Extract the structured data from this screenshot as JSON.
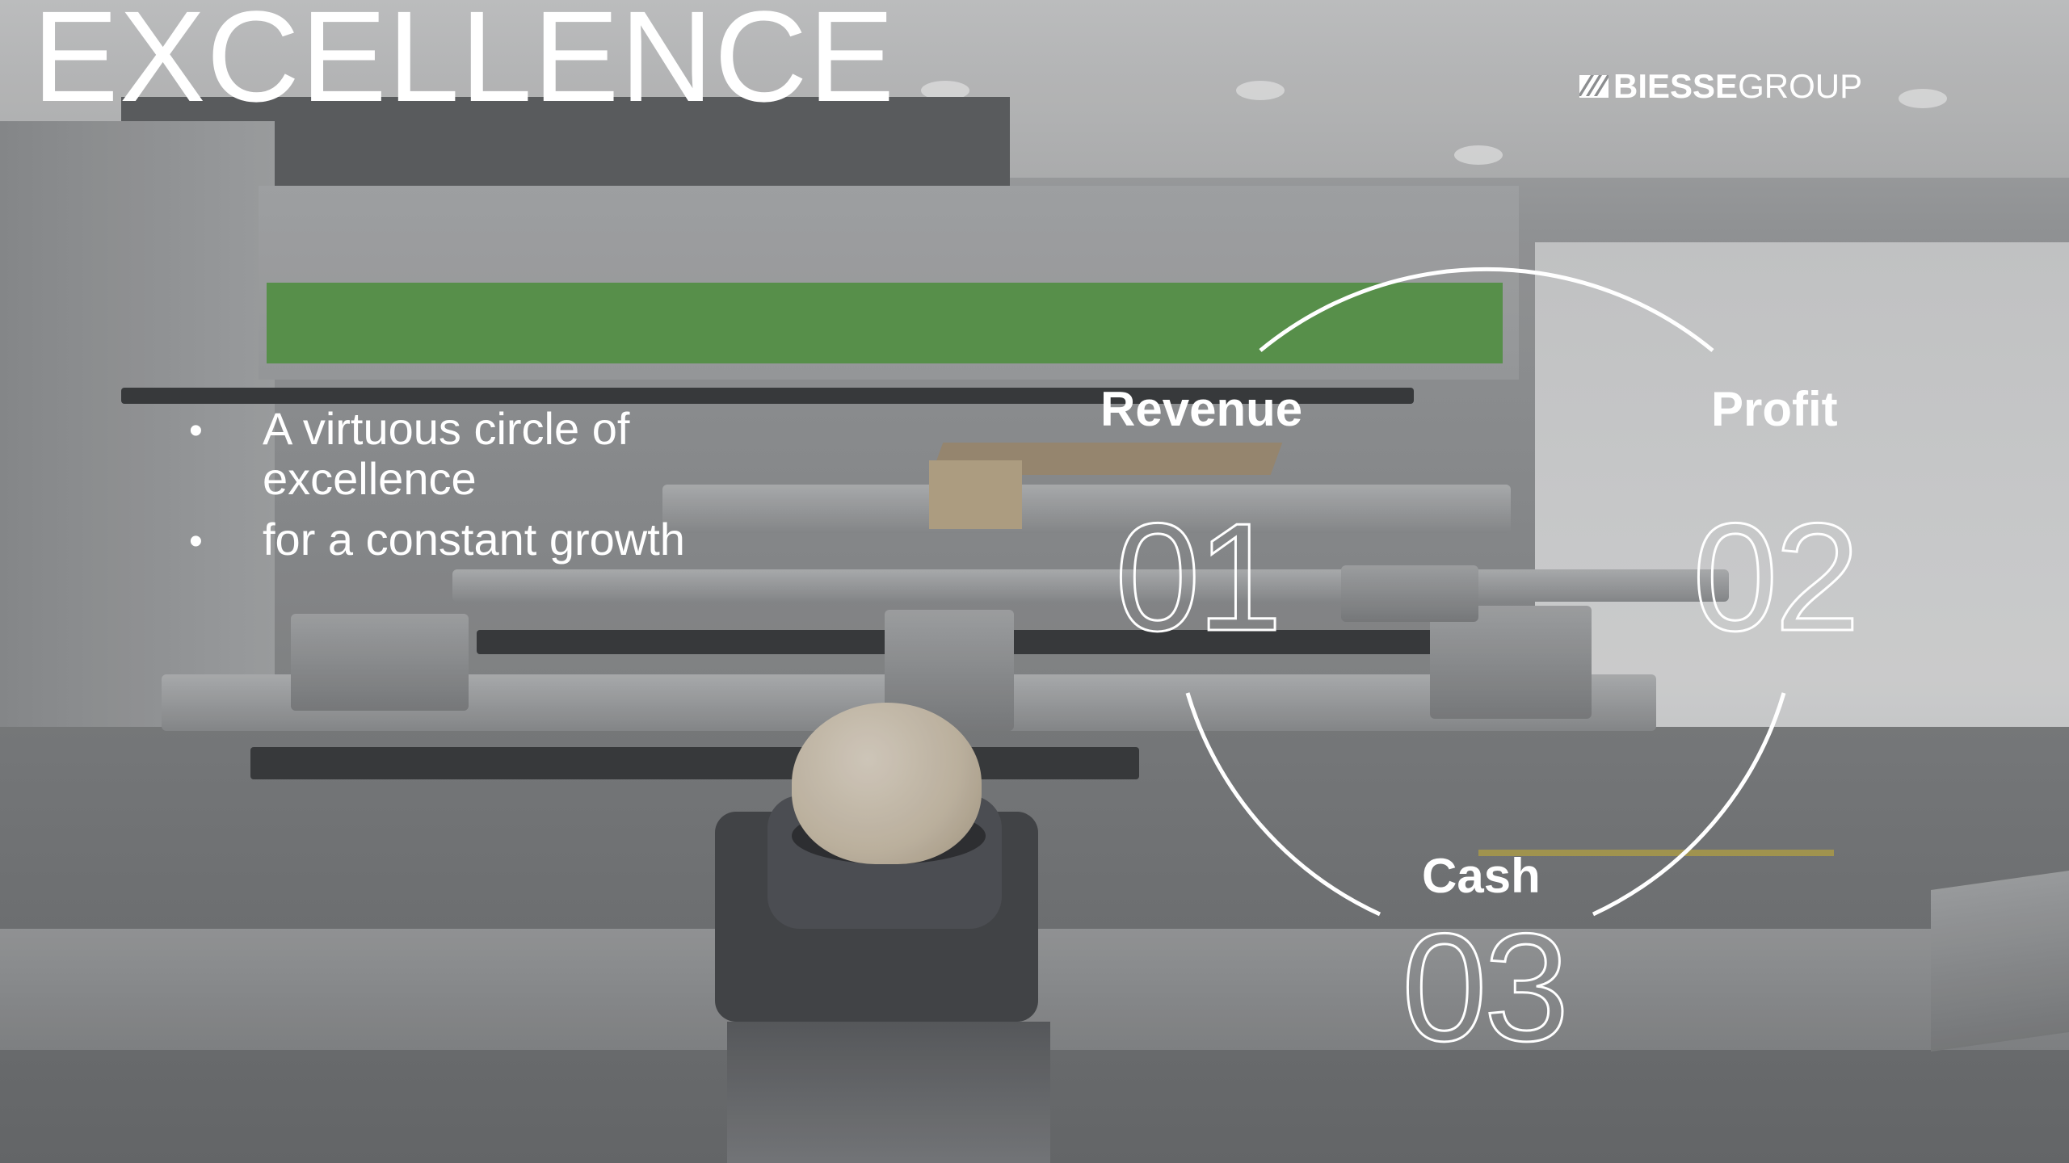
{
  "slide": {
    "title": "EXCELLENCE",
    "logo": {
      "bold": "BIESSE",
      "light": "GROUP"
    },
    "bullets": [
      {
        "text": "A virtuous circle of excellence"
      },
      {
        "text": "for a constant growth"
      }
    ],
    "cycle": [
      {
        "label": "Revenue",
        "number": "01"
      },
      {
        "label": "Profit",
        "number": "02"
      },
      {
        "label": "Cash",
        "number": "03"
      }
    ]
  }
}
